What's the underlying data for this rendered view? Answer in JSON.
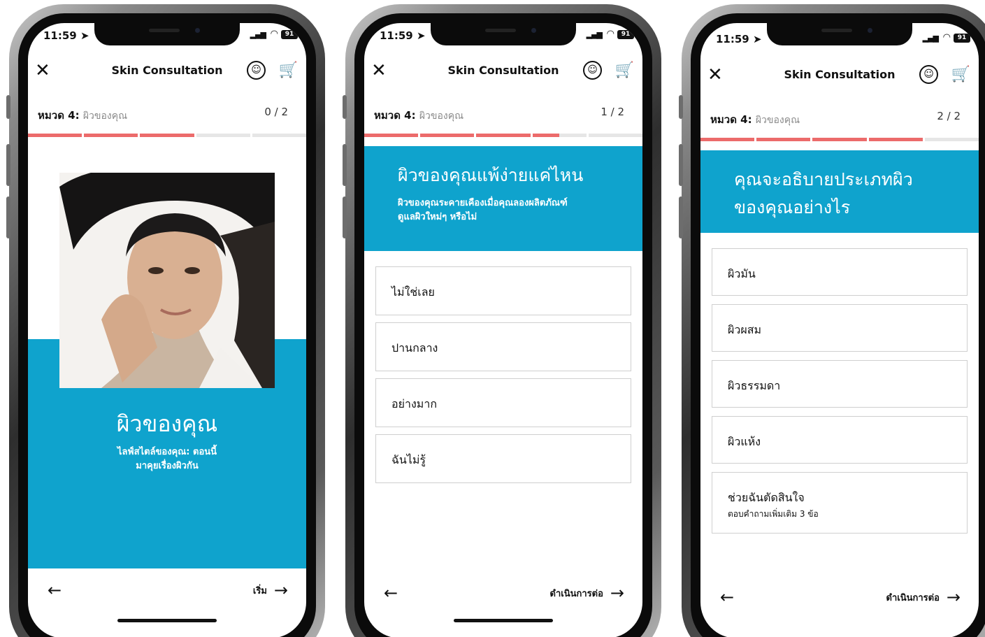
{
  "status": {
    "time": "11:59 ➤",
    "battery": "91"
  },
  "header": {
    "title": "Skin Consultation"
  },
  "section": {
    "prefix": "หมวด 4:",
    "category": "ผิวของคุณ"
  },
  "phone1": {
    "counter": "0 / 2",
    "progress": [
      1,
      1,
      1,
      0,
      0
    ],
    "title": "ผิวของคุณ",
    "subtitle_line1": "ไลฟ์สไตล์ของคุณ: ตอนนี้",
    "subtitle_line2": "มาคุยเรื่องผิวกัน",
    "next_label": "เริ่ม"
  },
  "phone2": {
    "counter": "1 / 2",
    "progress": [
      1,
      1,
      1,
      0.5,
      0
    ],
    "question": "ผิวของคุณแพ้ง่ายแค่ไหน",
    "sub_line1": "ผิวของคุณระคายเคืองเมื่อคุณลองผลิตภัณฑ์",
    "sub_line2": "ดูแลผิวใหม่ๆ หรือไม่",
    "options": [
      "ไม่ใช่เลย",
      "ปานกลาง",
      "อย่างมาก",
      "ฉันไม่รู้"
    ],
    "next_label": "ดำเนินการต่อ"
  },
  "phone3": {
    "counter": "2 / 2",
    "progress": [
      1,
      1,
      1,
      1,
      0
    ],
    "question_line1": "คุณจะอธิบายประเภทผิว",
    "question_line2": "ของคุณอย่างไร",
    "options": [
      "ผิวมัน",
      "ผิวผสม",
      "ผิวธรรมดา",
      "ผิวแห้ง",
      "ช่วยฉันตัดสินใจ"
    ],
    "option5_sub": "ตอบคำถามเพิ่มเติม 3 ข้อ",
    "next_label": "ดำเนินการต่อ"
  }
}
